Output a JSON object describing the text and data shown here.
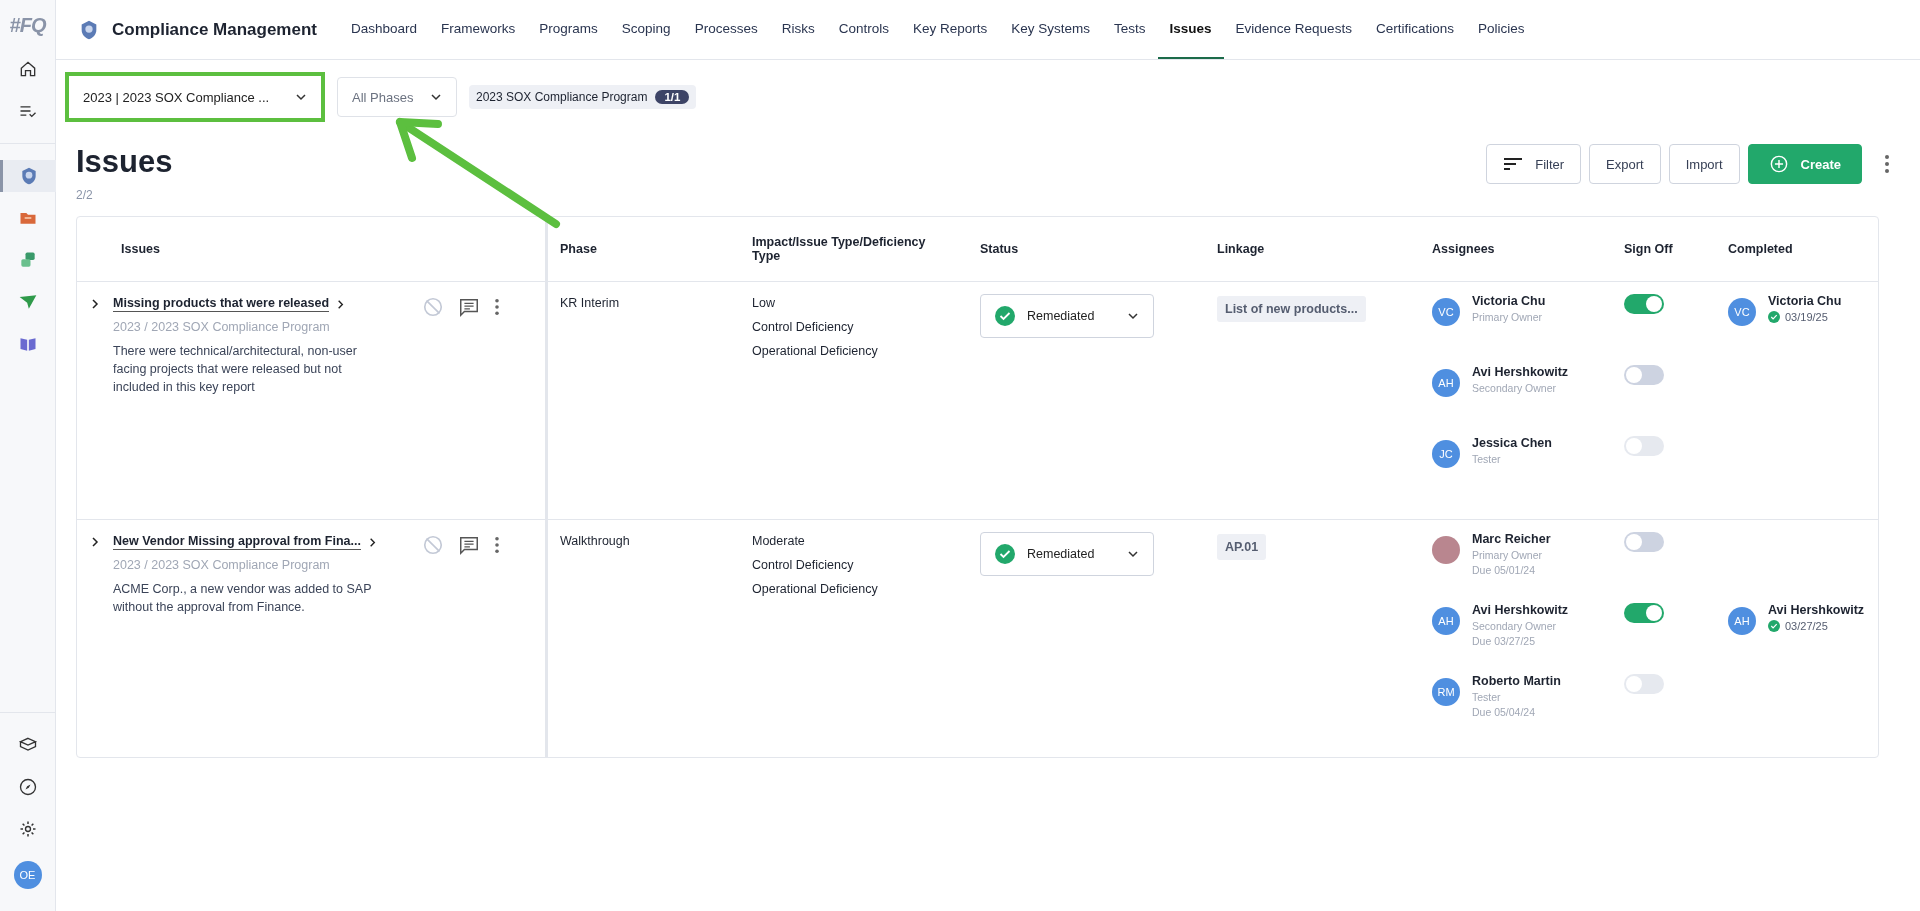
{
  "app": {
    "logo": "#FQ",
    "title": "Compliance Management",
    "user_initials": "OE"
  },
  "nav": [
    {
      "label": "Dashboard",
      "selected": false
    },
    {
      "label": "Frameworks",
      "selected": false
    },
    {
      "label": "Programs",
      "selected": false
    },
    {
      "label": "Scoping",
      "selected": false
    },
    {
      "label": "Processes",
      "selected": false
    },
    {
      "label": "Risks",
      "selected": false
    },
    {
      "label": "Controls",
      "selected": false
    },
    {
      "label": "Key Reports",
      "selected": false
    },
    {
      "label": "Key Systems",
      "selected": false
    },
    {
      "label": "Tests",
      "selected": false
    },
    {
      "label": "Issues",
      "selected": true
    },
    {
      "label": "Evidence Requests",
      "selected": false
    },
    {
      "label": "Certifications",
      "selected": false
    },
    {
      "label": "Policies",
      "selected": false
    }
  ],
  "filters": {
    "program": "2023 | 2023 SOX Compliance ...",
    "phase_placeholder": "All Phases",
    "chip": "2023 SOX Compliance Program",
    "chip_count": "1/1"
  },
  "page": {
    "title": "Issues",
    "count": "2/2",
    "buttons": {
      "filter": "Filter",
      "export": "Export",
      "import": "Import",
      "create": "Create"
    }
  },
  "table": {
    "columns": [
      "Issues",
      "Phase",
      "Impact/Issue Type/Deficiency Type",
      "Status",
      "Linkage",
      "Assignees",
      "Sign Off",
      "Completed"
    ],
    "rows": [
      {
        "title": "Missing products that were released",
        "program": "2023 / 2023 SOX Compliance Program",
        "description": "There were technical/architectural, non-user facing projects that were released but not included in this key report",
        "phase": "KR Interim",
        "impact": [
          "Low",
          "Control Deficiency",
          "Operational Deficiency"
        ],
        "status": "Remediated",
        "linkage": "List of new products...",
        "assignees": [
          {
            "kind": "initials",
            "initials": "VC",
            "name": "Victoria Chu",
            "role": "Primary Owner",
            "sign_off": {
              "on": true,
              "disabled": false
            },
            "completed": {
              "initials": "VC",
              "name": "Victoria Chu",
              "date": "03/19/25"
            }
          },
          {
            "kind": "initials",
            "initials": "AH",
            "name": "Avi Hershkowitz",
            "role": "Secondary Owner",
            "sign_off": {
              "on": false,
              "disabled": false
            }
          },
          {
            "kind": "initials",
            "initials": "JC",
            "name": "Jessica Chen",
            "role": "Tester",
            "sign_off": {
              "on": false,
              "disabled": true
            }
          }
        ]
      },
      {
        "title": "New Vendor Missing approval from Fina...",
        "program": "2023 / 2023 SOX Compliance Program",
        "description": "ACME Corp., a new vendor was added to SAP without the approval from Finance.",
        "phase": "Walkthrough",
        "impact": [
          "Moderate",
          "Control Deficiency",
          "Operational Deficiency"
        ],
        "status": "Remediated",
        "linkage": "AP.01",
        "assignees": [
          {
            "kind": "photo",
            "name": "Marc Reicher",
            "role": "Primary Owner",
            "due": "Due 05/01/24",
            "sign_off": {
              "on": false,
              "disabled": false
            }
          },
          {
            "kind": "initials",
            "initials": "AH",
            "name": "Avi Hershkowitz",
            "role": "Secondary Owner",
            "due": "Due 03/27/25",
            "sign_off": {
              "on": true,
              "disabled": false
            },
            "completed": {
              "initials": "AH",
              "name": "Avi Hershkowitz",
              "date": "03/27/25"
            }
          },
          {
            "kind": "initials",
            "initials": "RM",
            "name": "Roberto Martin",
            "role": "Tester",
            "due": "Due 05/04/24",
            "sign_off": {
              "on": false,
              "disabled": true
            }
          }
        ]
      }
    ]
  }
}
